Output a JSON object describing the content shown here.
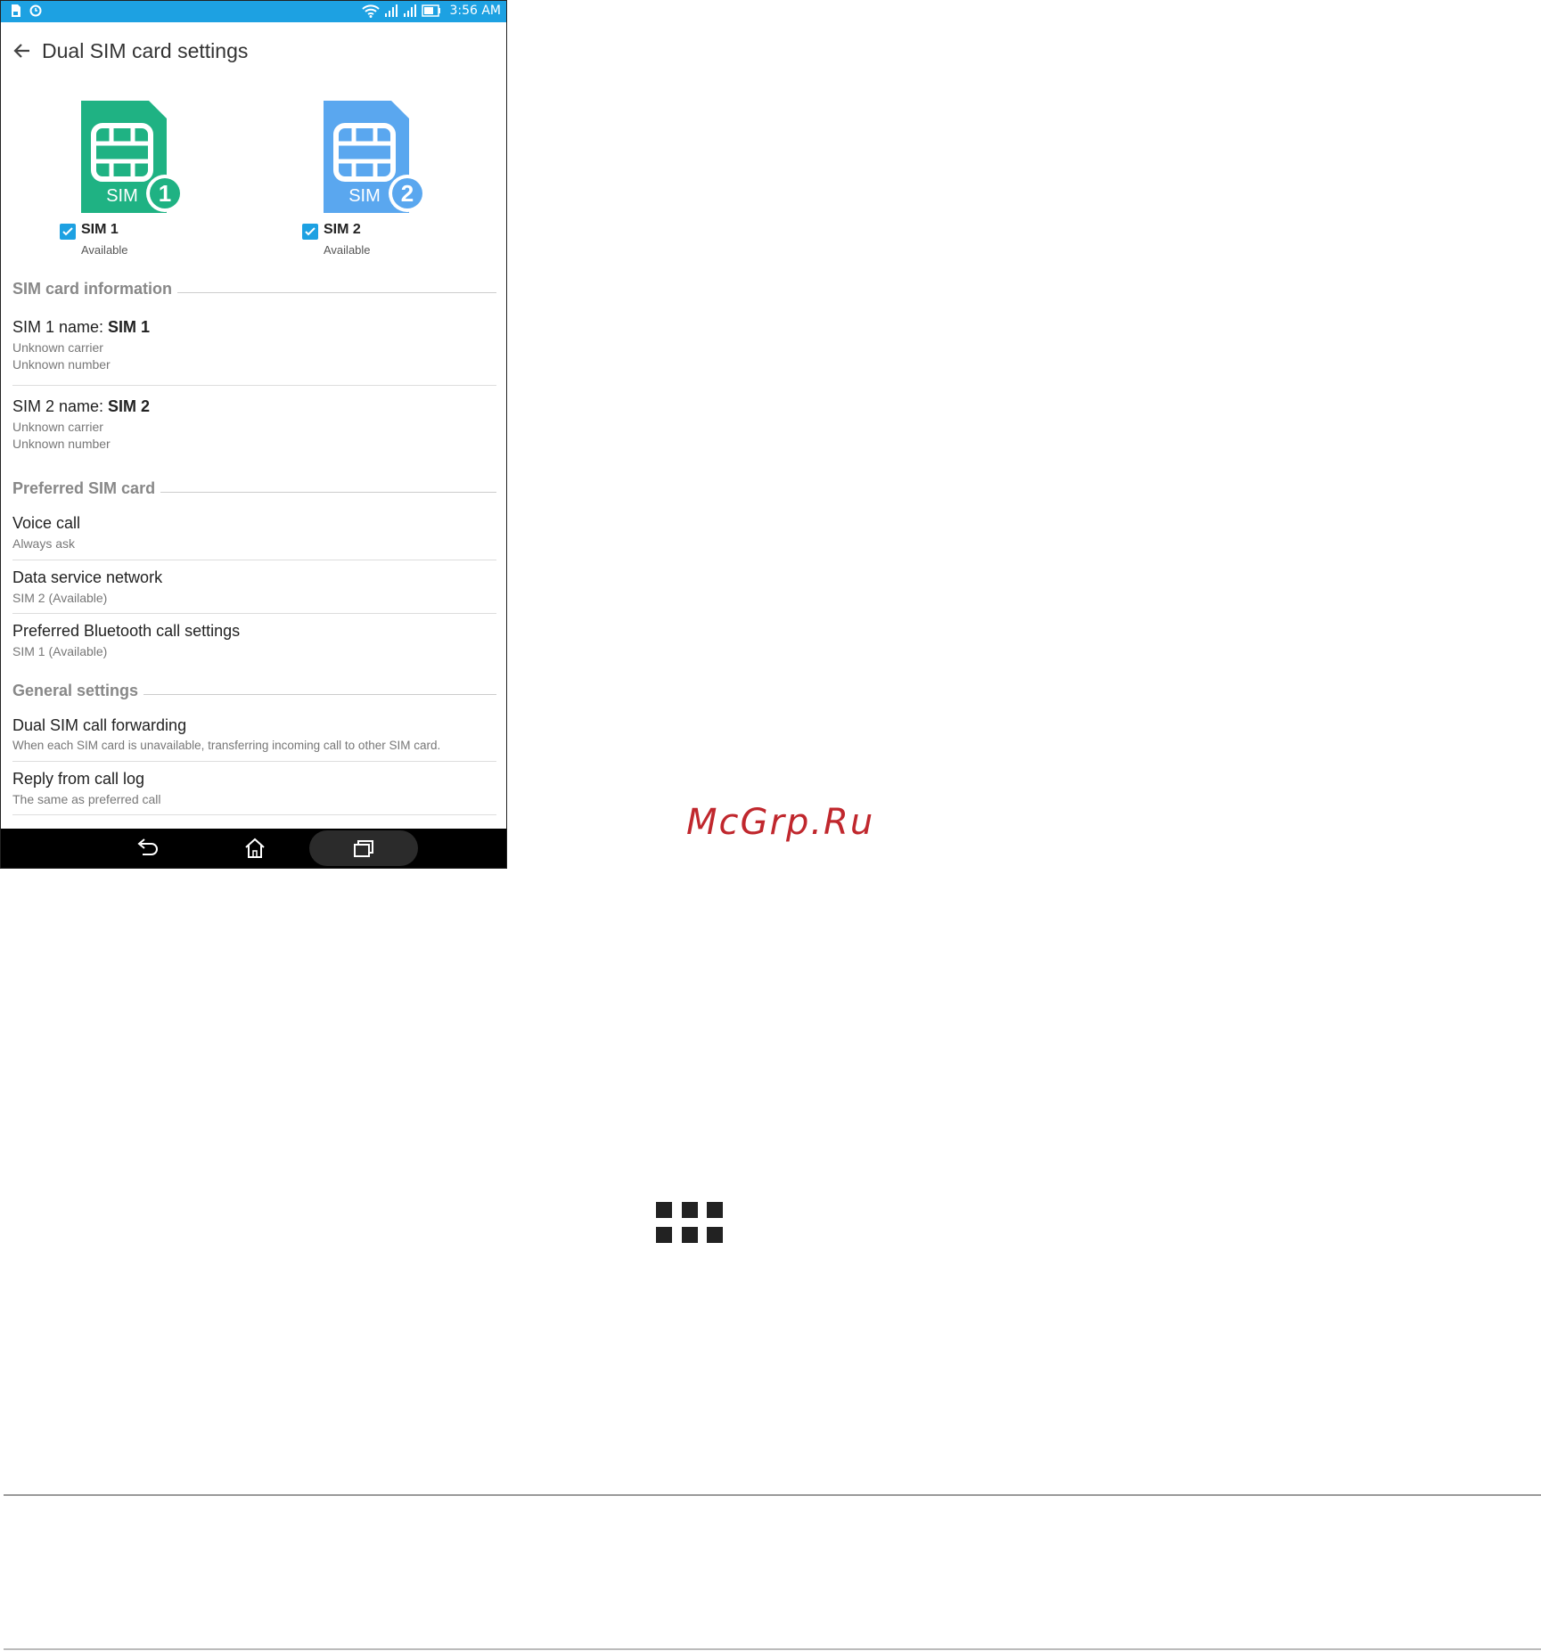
{
  "status_bar": {
    "time": "3:56 AM"
  },
  "app_bar": {
    "title": "Dual SIM card settings"
  },
  "sim_cards": [
    {
      "label": "SIM 1",
      "status": "Available",
      "card_text": "SIM",
      "number": "1",
      "color": "#1fb283"
    },
    {
      "label": "SIM 2",
      "status": "Available",
      "card_text": "SIM",
      "number": "2",
      "color": "#5aa7ef"
    }
  ],
  "sections": {
    "sim_info": {
      "header": "SIM card information",
      "items": [
        {
          "title_prefix": "SIM 1 name: ",
          "title_value": "SIM 1",
          "carrier": "Unknown carrier",
          "number": "Unknown number"
        },
        {
          "title_prefix": "SIM 2 name: ",
          "title_value": "SIM 2",
          "carrier": "Unknown carrier",
          "number": "Unknown number"
        }
      ]
    },
    "preferred": {
      "header": "Preferred SIM card",
      "items": [
        {
          "title": "Voice call",
          "subtitle": "Always ask"
        },
        {
          "title": "Data service network",
          "subtitle": "SIM 2 (Available)"
        },
        {
          "title": "Preferred Bluetooth call settings",
          "subtitle": "SIM 1 (Available)"
        }
      ]
    },
    "general": {
      "header": "General settings",
      "items": [
        {
          "title": "Dual SIM call forwarding",
          "subtitle": "When each SIM card is unavailable, transferring incoming call to other SIM card."
        },
        {
          "title": "Reply from call log",
          "subtitle": "The same as preferred call"
        }
      ]
    }
  },
  "nav_bar": {
    "icons": [
      "back-icon",
      "home-icon",
      "recents-icon"
    ]
  },
  "watermark": "McGrp.Ru",
  "colors": {
    "status_bar": "#1da1e2",
    "accent": "#1da1e2",
    "sim1": "#1fb283",
    "sim2": "#5aa7ef",
    "watermark": "#c0272d"
  }
}
